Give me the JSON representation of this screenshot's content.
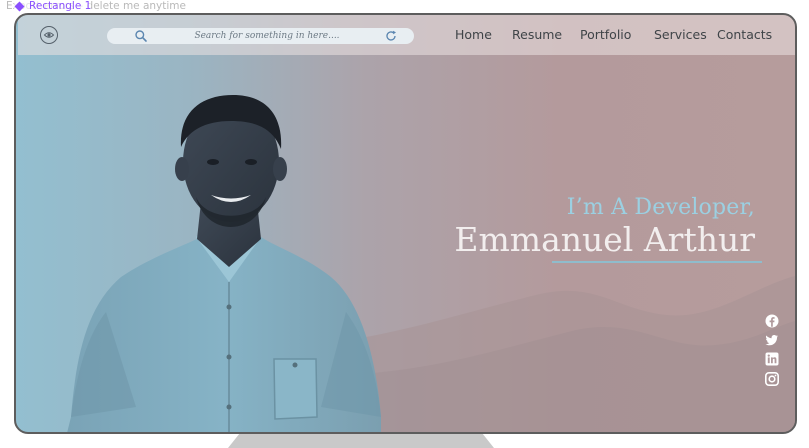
{
  "editor": {
    "hint": "Export errors – delete me anytime",
    "layer_label": "Rectangle 1"
  },
  "navbar": {
    "search_placeholder": "Search for something in here....",
    "links": [
      "Home",
      "Resume",
      "Portfolio",
      "Services",
      "Contacts"
    ]
  },
  "hero": {
    "subtitle": "I’m A Developer,",
    "name": "Emmanuel Arthur"
  },
  "socials": [
    "facebook-icon",
    "twitter-icon",
    "linkedin-icon",
    "instagram-icon"
  ],
  "colors": {
    "accent": "#9bd0e2",
    "name_text": "#f2eeee",
    "gradient_left": "#93bfd0",
    "gradient_right": "#b69c9c"
  }
}
